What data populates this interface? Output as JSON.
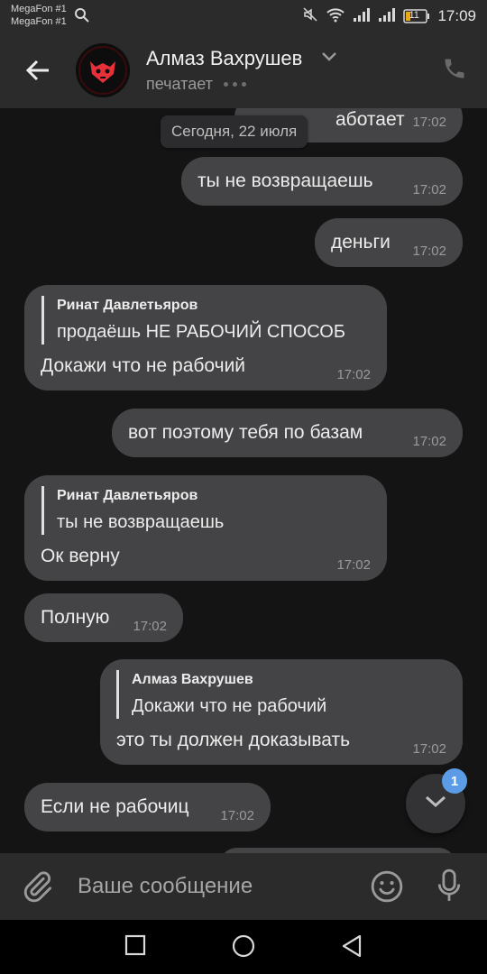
{
  "status_bar": {
    "carrier_1": "MegaFon #1",
    "carrier_2": "MegaFon #1",
    "battery_level": "11",
    "time": "17:09"
  },
  "header": {
    "contact_name": "Алмаз Вахрушев",
    "status": "печатает"
  },
  "chat": {
    "date_label": "Сегодня, 22 июля",
    "messages": [
      {
        "direction": "out",
        "text": "аботает",
        "time": "17:02"
      },
      {
        "direction": "out",
        "text": "ты не возвращаешь",
        "time": "17:02"
      },
      {
        "direction": "out",
        "text": "деньги",
        "time": "17:02"
      },
      {
        "direction": "in",
        "reply_to_name": "Ринат Давлетьяров",
        "reply_to_text": "продаёшь НЕ РАБОЧИЙ СПОСОБ",
        "text": "Докажи что не рабочий",
        "time": "17:02"
      },
      {
        "direction": "out",
        "text": "вот поэтому тебя по базам",
        "time": "17:02"
      },
      {
        "direction": "in",
        "reply_to_name": "Ринат Давлетьяров",
        "reply_to_text": "ты не возвращаешь",
        "text": "Ок верну",
        "time": "17:02"
      },
      {
        "direction": "in",
        "text": "Полную",
        "time": "17:02"
      },
      {
        "direction": "out",
        "reply_to_name": "Алмаз Вахрушев",
        "reply_to_text": "Докажи что не рабочий",
        "text": "это ты должен доказывать",
        "time": "17:02"
      },
      {
        "direction": "in",
        "text": "Если не рабочиц",
        "time": "17:02"
      }
    ],
    "unread_count": "1"
  },
  "composer": {
    "placeholder": "Ваше сообщение"
  },
  "colors": {
    "bar_background": "#2b2b2b",
    "chat_background": "#141414",
    "bubble": "#444446",
    "badge": "#5c9ce6",
    "avatar_accent": "#e8303a"
  },
  "icons": [
    "search-icon",
    "mute-icon",
    "wifi-icon",
    "signal-icon",
    "battery-icon",
    "back-arrow-icon",
    "chevron-down-icon",
    "phone-icon",
    "paperclip-icon",
    "emoji-icon",
    "microphone-icon",
    "square-icon",
    "circle-icon",
    "triangle-icon"
  ]
}
